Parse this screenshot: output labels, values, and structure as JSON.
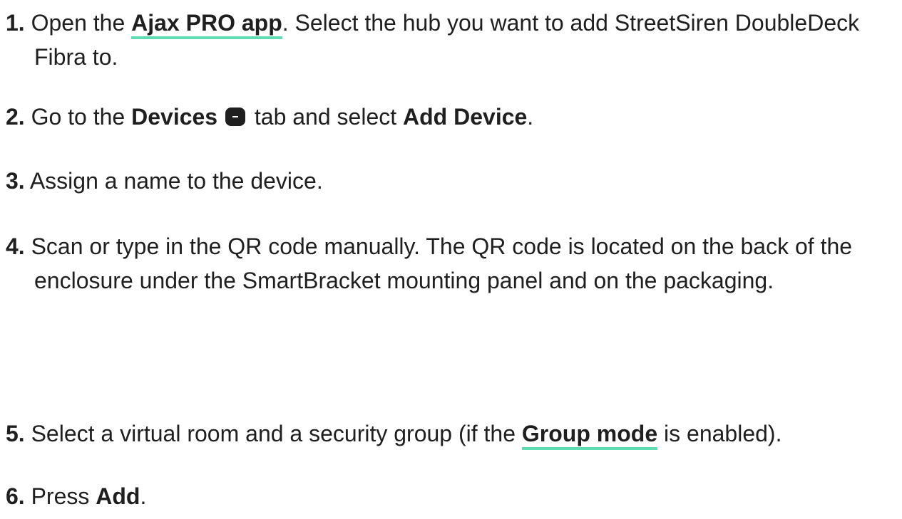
{
  "steps": [
    {
      "number": "1.",
      "before": "Open the ",
      "link": "Ajax PRO app",
      "after": ". Select the hub you want to add StreetSiren DoubleDeck Fibra to."
    },
    {
      "number": "2.",
      "before": "Go to the ",
      "bold1": "Devices",
      "icon": "devices-tab-icon",
      "middle": " tab and select ",
      "bold2": "Add Device",
      "after": "."
    },
    {
      "number": "3.",
      "text": "Assign a name to the device."
    },
    {
      "number": "4.",
      "text": "Scan or type in the QR code manually. The QR code is located on the back of the enclosure under the SmartBracket mounting panel and on the packaging."
    },
    {
      "number": "5.",
      "before": "Select a virtual room and a security group (if the ",
      "link": "Group mode",
      "after": " is enabled)."
    },
    {
      "number": "6.",
      "before": "Press ",
      "bold1": "Add",
      "after": "."
    }
  ],
  "colors": {
    "text": "#1f1f1f",
    "link_underline": "#5fdcb2",
    "background": "#ffffff"
  }
}
